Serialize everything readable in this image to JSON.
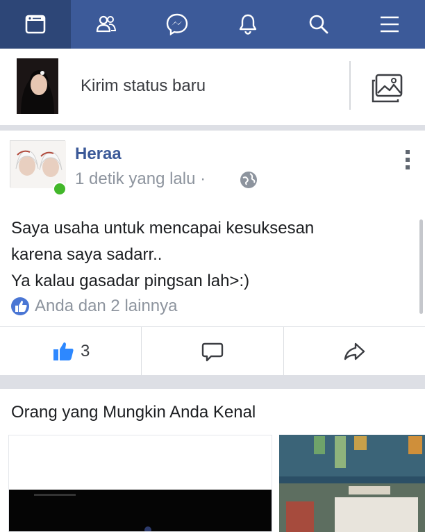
{
  "nav": {
    "tabs": [
      {
        "icon": "news-feed-icon",
        "active": true
      },
      {
        "icon": "friends-icon"
      },
      {
        "icon": "messenger-icon"
      },
      {
        "icon": "notifications-bell-icon"
      },
      {
        "icon": "search-icon"
      },
      {
        "icon": "menu-icon"
      }
    ]
  },
  "composer": {
    "prompt": "Kirim status baru",
    "photo_icon": "photo-icon"
  },
  "post": {
    "author": "Heraa",
    "timestamp": "1 detik yang lalu ·",
    "privacy_icon": "globe-icon",
    "lines": [
      "Saya usaha untuk mencapai kesuksesan",
      "karena saya sadarr..",
      "Ya kalau gasadar pingsan lah>:)"
    ],
    "reactions_text": "Anda dan 2 lainnya",
    "like_count": "3",
    "colors": {
      "brand": "#3b5998",
      "online": "#42b72a",
      "like": "#2d88ff"
    }
  },
  "pymk": {
    "title": "Orang yang Mungkin Anda Kenal"
  }
}
